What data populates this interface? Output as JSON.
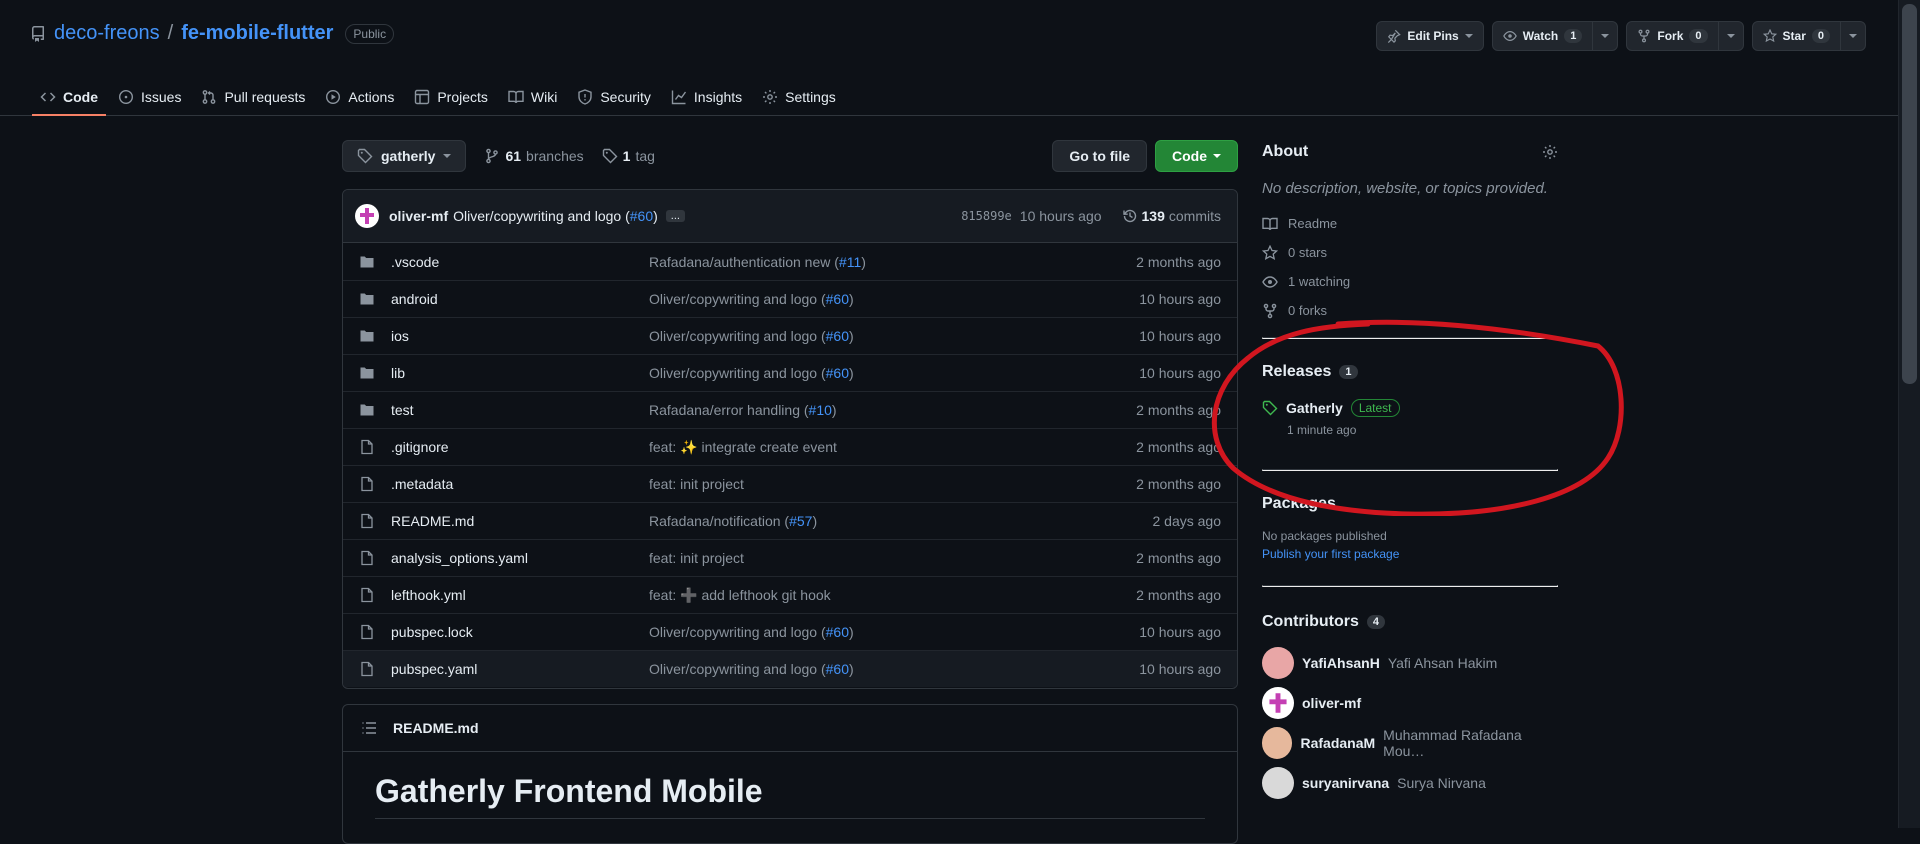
{
  "repo": {
    "owner": "deco-freons",
    "separator": "/",
    "name": "fe-mobile-flutter",
    "visibility": "Public"
  },
  "actions": {
    "edit_pins": "Edit Pins",
    "watch": "Watch",
    "watch_count": "1",
    "fork": "Fork",
    "fork_count": "0",
    "star": "Star",
    "star_count": "0"
  },
  "tabs": [
    {
      "label": "Code",
      "icon": "code-icon"
    },
    {
      "label": "Issues",
      "icon": "issue-icon"
    },
    {
      "label": "Pull requests",
      "icon": "pull-request-icon"
    },
    {
      "label": "Actions",
      "icon": "play-icon"
    },
    {
      "label": "Projects",
      "icon": "table-icon"
    },
    {
      "label": "Wiki",
      "icon": "book-icon"
    },
    {
      "label": "Security",
      "icon": "shield-icon"
    },
    {
      "label": "Insights",
      "icon": "graph-icon"
    },
    {
      "label": "Settings",
      "icon": "gear-icon"
    }
  ],
  "branch_bar": {
    "branch": "gatherly",
    "branches_count": "61",
    "branches_label": "branches",
    "tags_count": "1",
    "tags_label": "tag",
    "go_to_file": "Go to file",
    "code": "Code"
  },
  "latest_commit": {
    "author": "oliver-mf",
    "message": "Oliver/copywriting and logo (",
    "pr": "#60",
    "message_end": ")",
    "ellipsis": "...",
    "sha": "815899e",
    "time": "10 hours ago",
    "commits_count": "139",
    "commits_label": "commits"
  },
  "files": [
    {
      "type": "dir",
      "name": ".vscode",
      "msg": "Rafadana/authentication new (",
      "pr": "#11",
      "msg_end": ")",
      "date": "2 months ago"
    },
    {
      "type": "dir",
      "name": "android",
      "msg": "Oliver/copywriting and logo (",
      "pr": "#60",
      "msg_end": ")",
      "date": "10 hours ago"
    },
    {
      "type": "dir",
      "name": "ios",
      "msg": "Oliver/copywriting and logo (",
      "pr": "#60",
      "msg_end": ")",
      "date": "10 hours ago"
    },
    {
      "type": "dir",
      "name": "lib",
      "msg": "Oliver/copywriting and logo (",
      "pr": "#60",
      "msg_end": ")",
      "date": "10 hours ago"
    },
    {
      "type": "dir",
      "name": "test",
      "msg": "Rafadana/error handling (",
      "pr": "#10",
      "msg_end": ")",
      "date": "2 months ago"
    },
    {
      "type": "file",
      "name": ".gitignore",
      "msg": "feat: ✨ integrate create event",
      "pr": "",
      "msg_end": "",
      "date": "2 months ago"
    },
    {
      "type": "file",
      "name": ".metadata",
      "msg": "feat: init project",
      "pr": "",
      "msg_end": "",
      "date": "2 months ago"
    },
    {
      "type": "file",
      "name": "README.md",
      "msg": "Rafadana/notification (",
      "pr": "#57",
      "msg_end": ")",
      "date": "2 days ago"
    },
    {
      "type": "file",
      "name": "analysis_options.yaml",
      "msg": "feat: init project",
      "pr": "",
      "msg_end": "",
      "date": "2 months ago"
    },
    {
      "type": "file",
      "name": "lefthook.yml",
      "msg": "feat: ➕ add lefthook git hook",
      "pr": "",
      "msg_end": "",
      "date": "2 months ago"
    },
    {
      "type": "file",
      "name": "pubspec.lock",
      "msg": "Oliver/copywriting and logo (",
      "pr": "#60",
      "msg_end": ")",
      "date": "10 hours ago"
    },
    {
      "type": "file",
      "name": "pubspec.yaml",
      "msg": "Oliver/copywriting and logo (",
      "pr": "#60",
      "msg_end": ")",
      "date": "10 hours ago"
    }
  ],
  "readme": {
    "filename": "README.md",
    "title": "Gatherly Frontend Mobile"
  },
  "about": {
    "title": "About",
    "description": "No description, website, or topics provided.",
    "items": [
      {
        "icon": "book-icon",
        "label": "Readme"
      },
      {
        "icon": "star-icon",
        "label": "0 stars"
      },
      {
        "icon": "eye-icon",
        "label": "1 watching"
      },
      {
        "icon": "fork-icon",
        "label": "0 forks"
      }
    ]
  },
  "releases": {
    "title": "Releases",
    "count": "1",
    "name": "Gatherly",
    "badge": "Latest",
    "time": "1 minute ago"
  },
  "packages": {
    "title": "Packages",
    "text": "No packages published",
    "link": "Publish your first package"
  },
  "contributors": {
    "title": "Contributors",
    "count": "4",
    "list": [
      {
        "login": "YafiAhsanH",
        "name": "Yafi Ahsan Hakim",
        "color": "#e8a6a6"
      },
      {
        "login": "oliver-mf",
        "name": "",
        "color": "#ffffff"
      },
      {
        "login": "RafadanaM",
        "name": "Muhammad Rafadana Mou…",
        "color": "#e6b89c"
      },
      {
        "login": "suryanirvana",
        "name": "Surya Nirvana",
        "color": "#d9d9d9"
      }
    ]
  },
  "colors": {
    "accent": "#4493f8",
    "green": "#238636",
    "annotation": "#d1161f",
    "tab_underline": "#f78166"
  }
}
